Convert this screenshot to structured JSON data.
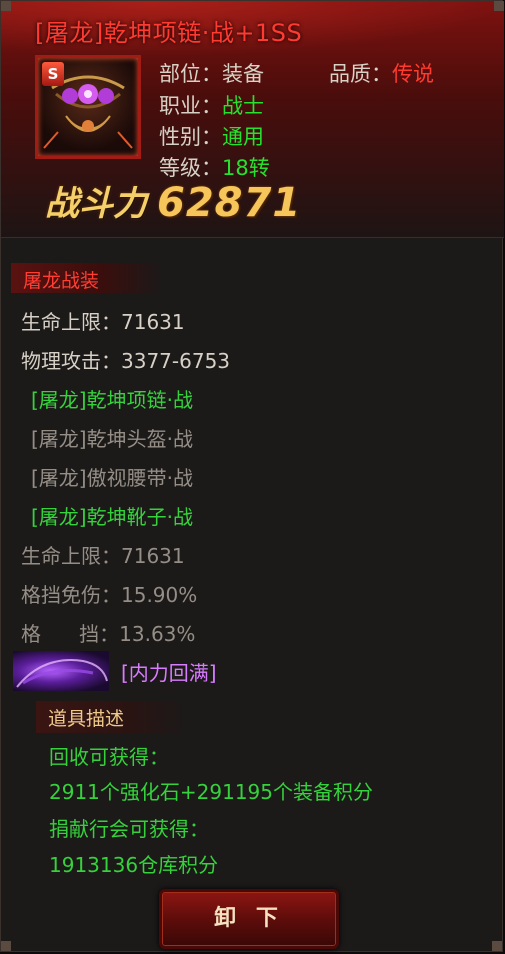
{
  "item": {
    "title": "[屠龙]乾坤项链·战+1SS",
    "badge": "S",
    "slot_label": "部位：",
    "slot_value": "装备",
    "quality_label": "品质：",
    "quality_value": "传说",
    "class_label": "职业：",
    "class_value": "战士",
    "gender_label": "性别：",
    "gender_value": "通用",
    "level_label": "等级：",
    "level_value": "18转",
    "power_label": "战斗力",
    "power_value": "62871"
  },
  "set": {
    "title": "屠龙战装",
    "base_stats": [
      "生命上限：71631",
      "物理攻击：3377-6753"
    ],
    "pieces": [
      {
        "text": "[屠龙]乾坤项链·战",
        "owned": true
      },
      {
        "text": "[屠龙]乾坤头盔·战",
        "owned": false
      },
      {
        "text": "[屠龙]傲视腰带·战",
        "owned": false
      },
      {
        "text": "[屠龙]乾坤靴子·战",
        "owned": true
      }
    ],
    "bonus_stats": [
      "生命上限：71631",
      "格挡免伤：15.90%",
      "格      挡：13.63%"
    ],
    "skill": "[内力回满]"
  },
  "description": {
    "title": "道具描述",
    "lines": [
      "回收可获得：",
      "2911个强化石+291195个装备积分",
      "捐献行会可获得：",
      "1913136仓库积分"
    ]
  },
  "actions": {
    "unequip_label": "卸 下"
  },
  "colors": {
    "title": "#ff3a30",
    "green": "#35d23c",
    "grey": "#948e86",
    "purple": "#d77bff",
    "gold": "#f6c65a"
  }
}
